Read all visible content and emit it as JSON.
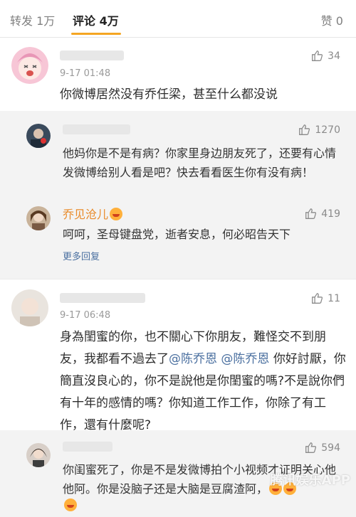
{
  "tabs": {
    "repost": "转发 1万",
    "comment": "评论 4万",
    "like": "赞 0"
  },
  "colors": {
    "accent": "#f5a623",
    "link": "#4b70a0",
    "name_orange": "#e98b2a"
  },
  "comments": [
    {
      "time": "9-17 01:48",
      "likes": "34",
      "text": "你微博居然没有乔任梁，甚至什么都没说",
      "replies": [
        {
          "likes": "1270",
          "text": "他妈你是不是有病？你家里身边朋友死了，还要有心情发微博给别人看是吧？快去看看医生你有没有病！"
        },
        {
          "name": "乔见沧儿",
          "likes": "419",
          "text": "呵呵，圣母键盘党，逝者安息，何必昭告天下"
        }
      ],
      "more": "更多回复"
    },
    {
      "time": "9-17 06:48",
      "likes": "11",
      "text_parts": {
        "a": "身為閨蜜的你，也不關心下你朋友，難怪交不到朋友，我都看不過去了",
        "mention1": "@陈乔恩",
        "mention2": "@陈乔恩",
        "b": "你好討厭，你簡直沒良心的，你不是說他是你閨蜜的嗎?不是說你們有十年的感情的嗎？你知道工作工作，你除了有工作，還有什麼呢?"
      },
      "replies": [
        {
          "likes": "594",
          "text": "你闺蜜死了，你是不是发微博拍个小视频才证明关心他他阿。你是没脑子还是大脑是豆腐渣阿，"
        }
      ]
    }
  ],
  "watermark": "腾讯娱乐APP"
}
